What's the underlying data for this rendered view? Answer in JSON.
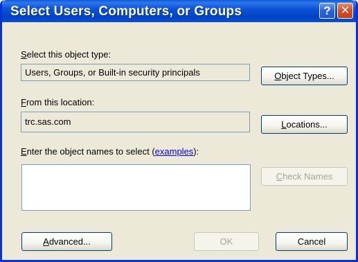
{
  "window": {
    "title": "Select Users, Computers, or Groups",
    "help_label": "?",
    "close_label": "✕"
  },
  "object_type": {
    "label_underlined": "S",
    "label_rest": "elect this object type:",
    "value": "Users, Groups, or Built-in security principals",
    "button_underlined": "O",
    "button_rest": "bject Types..."
  },
  "location": {
    "label_underlined": "F",
    "label_rest": "rom this location:",
    "value": "trc.sas.com",
    "button_underlined": "L",
    "button_rest": "ocations..."
  },
  "names": {
    "label_underlined": "E",
    "label_rest": "nter the object names to select (",
    "link_text": "examples",
    "label_suffix": "):",
    "value": "",
    "check_underlined": "C",
    "check_rest": "heck Names"
  },
  "footer": {
    "advanced_prefix": "",
    "advanced_underlined": "A",
    "advanced_rest": "dvanced...",
    "ok_label": "OK",
    "cancel_label": "Cancel"
  },
  "colors": {
    "title_bar": "#0054e3",
    "dialog_bg": "#ece9d8",
    "close_button": "#d7532c",
    "link": "#0000ff",
    "disabled_text": "#a6a59a"
  }
}
